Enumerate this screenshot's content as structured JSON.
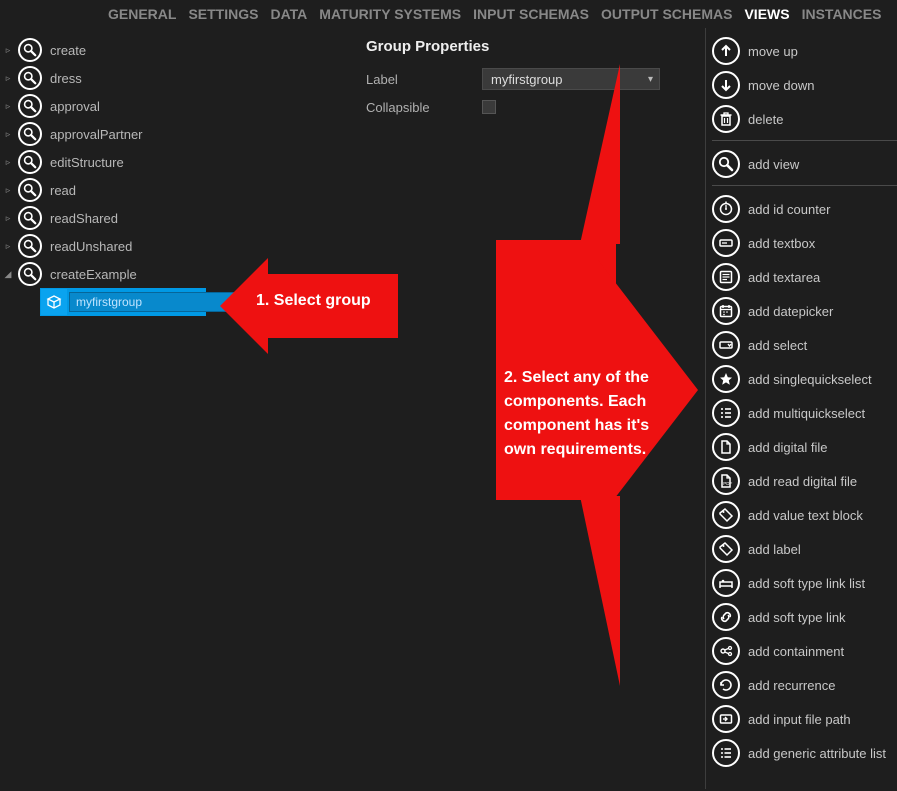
{
  "tabs": [
    {
      "label": "GENERAL",
      "active": false
    },
    {
      "label": "SETTINGS",
      "active": false
    },
    {
      "label": "DATA",
      "active": false
    },
    {
      "label": "MATURITY SYSTEMS",
      "active": false
    },
    {
      "label": "INPUT SCHEMAS",
      "active": false
    },
    {
      "label": "OUTPUT SCHEMAS",
      "active": false
    },
    {
      "label": "VIEWS",
      "active": true
    },
    {
      "label": "INSTANCES",
      "active": false
    }
  ],
  "tree": {
    "items": [
      {
        "label": "create",
        "expanded": false
      },
      {
        "label": "dress",
        "expanded": false
      },
      {
        "label": "approval",
        "expanded": false
      },
      {
        "label": "approvalPartner",
        "expanded": false
      },
      {
        "label": "editStructure",
        "expanded": false
      },
      {
        "label": "read",
        "expanded": false
      },
      {
        "label": "readShared",
        "expanded": false
      },
      {
        "label": "readUnshared",
        "expanded": false
      },
      {
        "label": "createExample",
        "expanded": true
      }
    ],
    "group_placeholder": "myfirstgroup"
  },
  "props": {
    "title": "Group Properties",
    "label_label": "Label",
    "label_select_value": "myfirstgroup",
    "collapsible_label": "Collapsible"
  },
  "actions_top": [
    {
      "icon": "arrow-up",
      "label": "move up"
    },
    {
      "icon": "arrow-down",
      "label": "move down"
    },
    {
      "icon": "trash",
      "label": "delete"
    }
  ],
  "actions_view": [
    {
      "icon": "magnify",
      "label": "add view"
    }
  ],
  "actions_components": [
    {
      "icon": "counter",
      "label": "add id counter"
    },
    {
      "icon": "textbox",
      "label": "add textbox"
    },
    {
      "icon": "textarea",
      "label": "add textarea"
    },
    {
      "icon": "calendar",
      "label": "add datepicker"
    },
    {
      "icon": "select",
      "label": "add select"
    },
    {
      "icon": "star",
      "label": "add singlequickselect"
    },
    {
      "icon": "list-check",
      "label": "add multiquickselect"
    },
    {
      "icon": "file",
      "label": "add digital file"
    },
    {
      "icon": "file-read",
      "label": "add read digital file"
    },
    {
      "icon": "tag",
      "label": "add value text block"
    },
    {
      "icon": "tag",
      "label": "add label"
    },
    {
      "icon": "bed",
      "label": "add soft type link list"
    },
    {
      "icon": "link",
      "label": "add soft type link"
    },
    {
      "icon": "contain",
      "label": "add containment"
    },
    {
      "icon": "recur",
      "label": "add recurrence"
    },
    {
      "icon": "input-path",
      "label": "add input file path"
    },
    {
      "icon": "generic-list",
      "label": "add generic attribute list"
    }
  ],
  "annotations": {
    "left": "1. Select group",
    "right": "2. Select any of the components. Each component has it's own requirements."
  }
}
